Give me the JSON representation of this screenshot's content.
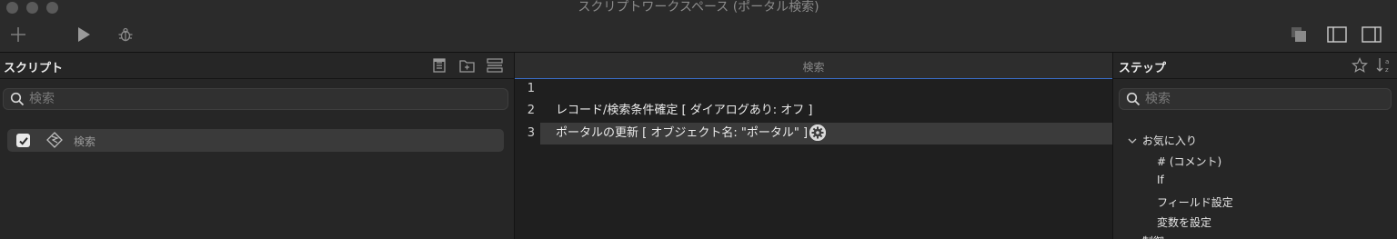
{
  "window": {
    "title": "スクリプトワークスペース (ポータル検索)"
  },
  "toolbar": {
    "new_icon": "plus-icon",
    "run_icon": "play-icon",
    "debug_icon": "bug-icon",
    "right_icons": [
      "copy-icon",
      "left-sidebar-icon",
      "right-sidebar-icon"
    ]
  },
  "scripts_panel": {
    "title": "スクリプト",
    "search_placeholder": "検索",
    "items": [
      {
        "label": "検索",
        "checked": true
      }
    ]
  },
  "editor": {
    "tab_title": "検索",
    "lines": [
      {
        "num": "1",
        "text": ""
      },
      {
        "num": "2",
        "text": "レコード/検索条件確定 [ ダイアログあり: オフ ]"
      },
      {
        "num": "3",
        "text": "ポータルの更新 [ オブジェクト名: \"ポータル\" ]"
      }
    ]
  },
  "steps_panel": {
    "title": "ステップ",
    "search_placeholder": "検索",
    "category": "お気に入り",
    "items": [
      "# (コメント)",
      "If",
      "フィールド設定",
      "変数を設定"
    ],
    "next_category": "制御"
  },
  "colors": {
    "accent": "#3a6ec9",
    "background": "#1e1e1e",
    "panel": "#262626"
  }
}
